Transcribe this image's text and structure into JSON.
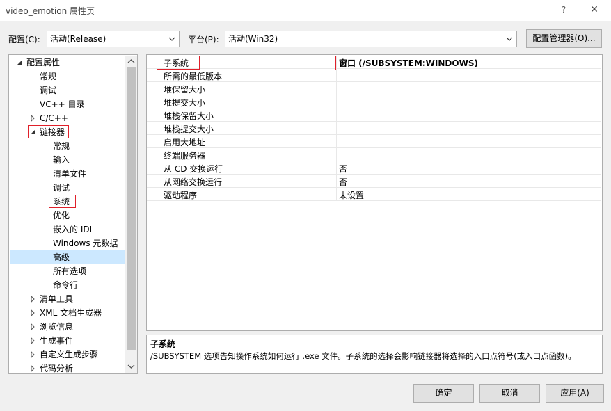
{
  "window": {
    "title": "video_emotion 属性页",
    "help_glyph": "?",
    "close_glyph": "✕"
  },
  "toolbar": {
    "config_label": "配置(C):",
    "config_value": "活动(Release)",
    "platform_label": "平台(P):",
    "platform_value": "活动(Win32)",
    "config_manager_label": "配置管理器(O)..."
  },
  "tree": {
    "items": [
      {
        "label": "配置属性",
        "level": 0,
        "arrow": "expanded"
      },
      {
        "label": "常规",
        "level": 1,
        "arrow": "none"
      },
      {
        "label": "调试",
        "level": 1,
        "arrow": "none"
      },
      {
        "label": "VC++ 目录",
        "level": 1,
        "arrow": "none"
      },
      {
        "label": "C/C++",
        "level": 1,
        "arrow": "collapsed"
      },
      {
        "label": "链接器",
        "level": 1,
        "arrow": "expanded"
      },
      {
        "label": "常规",
        "level": 2,
        "arrow": "none"
      },
      {
        "label": "输入",
        "level": 2,
        "arrow": "none"
      },
      {
        "label": "清单文件",
        "level": 2,
        "arrow": "none"
      },
      {
        "label": "调试",
        "level": 2,
        "arrow": "none"
      },
      {
        "label": "系统",
        "level": 2,
        "arrow": "none"
      },
      {
        "label": "优化",
        "level": 2,
        "arrow": "none"
      },
      {
        "label": "嵌入的 IDL",
        "level": 2,
        "arrow": "none"
      },
      {
        "label": "Windows 元数据",
        "level": 2,
        "arrow": "none"
      },
      {
        "label": "高级",
        "level": 2,
        "arrow": "none"
      },
      {
        "label": "所有选项",
        "level": 2,
        "arrow": "none"
      },
      {
        "label": "命令行",
        "level": 2,
        "arrow": "none"
      },
      {
        "label": "清单工具",
        "level": 1,
        "arrow": "collapsed"
      },
      {
        "label": "XML 文档生成器",
        "level": 1,
        "arrow": "collapsed"
      },
      {
        "label": "浏览信息",
        "level": 1,
        "arrow": "collapsed"
      },
      {
        "label": "生成事件",
        "level": 1,
        "arrow": "collapsed"
      },
      {
        "label": "自定义生成步骤",
        "level": 1,
        "arrow": "collapsed"
      },
      {
        "label": "代码分析",
        "level": 1,
        "arrow": "collapsed"
      }
    ]
  },
  "properties": {
    "rows": [
      {
        "name": "子系统",
        "value": "窗口 (/SUBSYSTEM:WINDOWS)"
      },
      {
        "name": "所需的最低版本",
        "value": ""
      },
      {
        "name": "堆保留大小",
        "value": ""
      },
      {
        "name": "堆提交大小",
        "value": ""
      },
      {
        "name": "堆栈保留大小",
        "value": ""
      },
      {
        "name": "堆栈提交大小",
        "value": ""
      },
      {
        "name": "启用大地址",
        "value": ""
      },
      {
        "name": "终端服务器",
        "value": ""
      },
      {
        "name": "从 CD 交换运行",
        "value": "否"
      },
      {
        "name": "从网络交换运行",
        "value": "否"
      },
      {
        "name": "驱动程序",
        "value": "未设置"
      }
    ]
  },
  "description": {
    "title": "子系统",
    "text": "/SUBSYSTEM 选项告知操作系统如何运行 .exe 文件。子系统的选择会影响链接器将选择的入口点符号(或入口点函数)。"
  },
  "buttons": {
    "ok": "确定",
    "cancel": "取消",
    "apply": "应用(A)"
  },
  "colors": {
    "selection": "#cce8ff",
    "highlight_border": "#e0202a",
    "window_bg": "#f0f0f0"
  }
}
